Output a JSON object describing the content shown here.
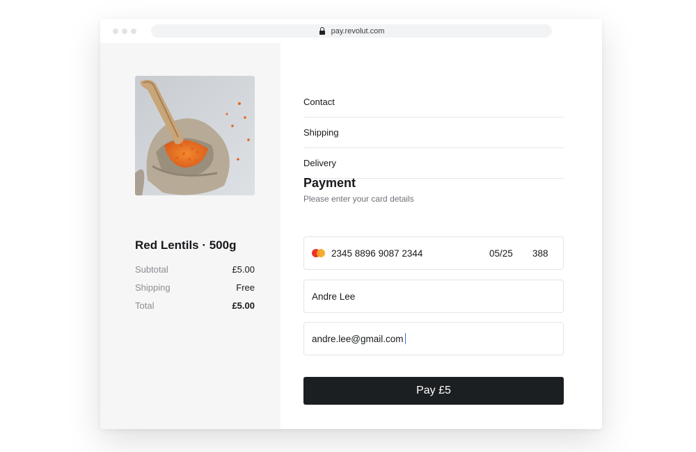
{
  "browser": {
    "url": "pay.revolut.com"
  },
  "product": {
    "image_icon": "lentils-product-image",
    "name": "Red Lentils · 500g"
  },
  "summary": {
    "subtotal_label": "Subtotal",
    "subtotal_value": "£5.00",
    "shipping_label": "Shipping",
    "shipping_value": "Free",
    "total_label": "Total",
    "total_value": "£5.00"
  },
  "steps": [
    {
      "label": "Contact"
    },
    {
      "label": "Shipping"
    },
    {
      "label": "Delivery"
    }
  ],
  "payment": {
    "title": "Payment",
    "subtitle": "Please enter your card details",
    "card_brand_icon": "mastercard-icon",
    "card_number": "2345 8896 9087 2344",
    "card_expiry": "05/25",
    "card_cvc": "388",
    "name_value": "Andre Lee",
    "email_value": "andre.lee@gmail.com",
    "pay_button_label": "Pay £5"
  },
  "colors": {
    "button_bg": "#1c1f21",
    "left_panel_bg": "#f6f6f6",
    "caret": "#3b6fd8"
  }
}
